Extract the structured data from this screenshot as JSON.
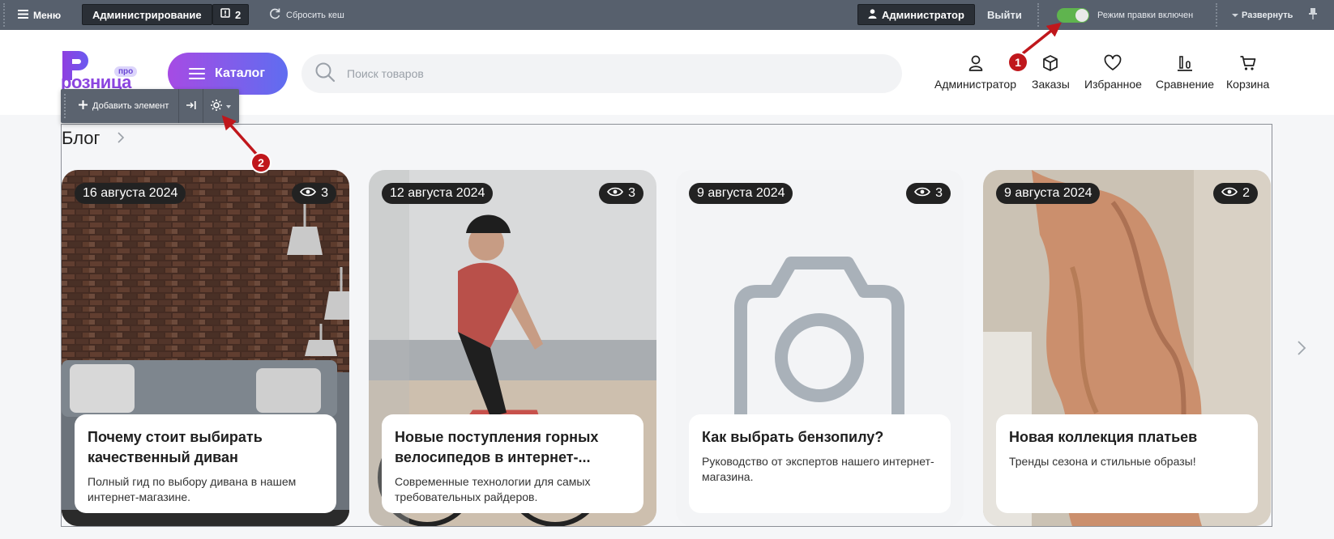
{
  "admin_bar": {
    "menu": "Меню",
    "administration": "Администрирование",
    "notifications_count": "2",
    "clear_cache": "Сбросить кеш",
    "user": "Администратор",
    "logout": "Выйти",
    "edit_mode": "Режим правки включен",
    "expand": "Развернуть"
  },
  "header": {
    "logo_word": "розница",
    "logo_badge": "про",
    "catalog": "Каталог",
    "search_placeholder": "Поиск товаров",
    "links": {
      "account": "Администратор",
      "orders": "Заказы",
      "favorites": "Избранное",
      "compare": "Сравнение",
      "cart": "Корзина"
    }
  },
  "edit_toolbar": {
    "add_element": "Добавить элемент"
  },
  "blog": {
    "title": "Блог",
    "cards": [
      {
        "date": "16 августа 2024",
        "views": "3",
        "title": "Почему стоит выбирать качественный диван",
        "text": "Полный гид по выбору дивана в нашем интернет-магазине."
      },
      {
        "date": "12 августа 2024",
        "views": "3",
        "title": "Новые поступления горных велосипедов в интернет-...",
        "text": "Современные технологии для самых требовательных райдеров."
      },
      {
        "date": "9 августа 2024",
        "views": "3",
        "title": "Как выбрать бензопилу?",
        "text": "Руководство от экспертов нашего интернет-магазина."
      },
      {
        "date": "9 августа 2024",
        "views": "2",
        "title": "Новая коллекция платьев",
        "text": "Тренды сезона и стильные образы!"
      }
    ]
  },
  "annotations": {
    "first": "1",
    "second": "2"
  },
  "colors": {
    "accent_start": "#a64be4",
    "accent_end": "#5f6df0",
    "admin_bar": "#57606d",
    "toggle_on": "#5fb44e",
    "annotation": "#c0171c"
  }
}
